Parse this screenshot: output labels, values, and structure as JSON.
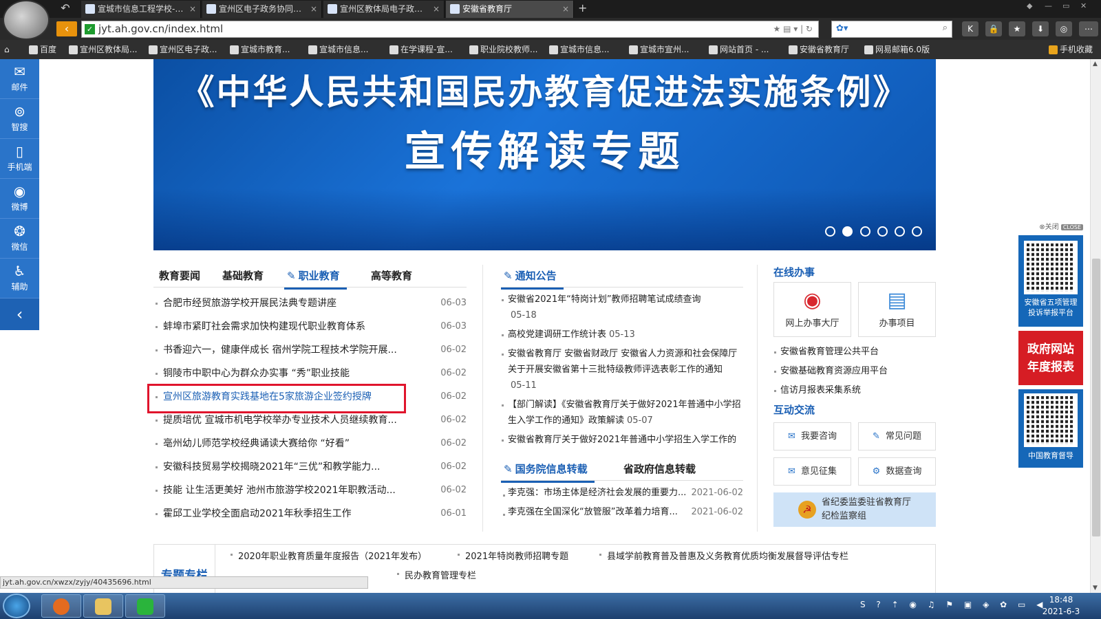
{
  "browser": {
    "tabs": [
      {
        "label": "宣城市信息工程学校-…",
        "close": "×"
      },
      {
        "label": "宣州区电子政务协同…",
        "close": "×"
      },
      {
        "label": "宣州区教体局电子政…",
        "close": "×"
      },
      {
        "label": "安徽省教育厅",
        "close": "×"
      }
    ],
    "new_tab": "+",
    "url": "jyt.ah.gov.cn/index.html",
    "bookmarks": [
      "百度",
      "宣州区教体局...",
      "宣州区电子政...",
      "宣城市教育...",
      "宣城市信息...",
      "在学课程-宣...",
      "职业院校教师...",
      "宣城市信息...",
      "宣城市宣州...",
      "网站首页 - ...",
      "安徽省教育厅",
      "网易邮箱6.0版"
    ],
    "mobile_fav": "手机收藏",
    "status_url": "jyt.ah.gov.cn/xwzx/zyjy/40435696.html"
  },
  "sidebar": {
    "items": [
      {
        "label": "邮件",
        "icon": "mail-icon"
      },
      {
        "label": "智搜",
        "icon": "search-icon"
      },
      {
        "label": "手机端",
        "icon": "phone-icon"
      },
      {
        "label": "微博",
        "icon": "weibo-icon"
      },
      {
        "label": "微信",
        "icon": "wechat-icon"
      },
      {
        "label": "辅助",
        "icon": "accessibility-icon"
      }
    ],
    "collapse": "‹"
  },
  "banner": {
    "line1": "《中华人民共和国民办教育促进法实施条例》",
    "line2": "宣传解读专题",
    "active_dot": 2,
    "dots": 6
  },
  "news": {
    "tabs": [
      "教育要闻",
      "基础教育",
      "职业教育",
      "高等教育"
    ],
    "active_tab": "职业教育",
    "items": [
      {
        "title": "合肥市经贸旅游学校开展民法典专题讲座",
        "date": "06-03"
      },
      {
        "title": "蚌埠市紧盯社会需求加快构建现代职业教育体系",
        "date": "06-03"
      },
      {
        "title": "书香迎六一，健康伴成长 宿州学院工程技术学院开展...",
        "date": "06-02"
      },
      {
        "title": "铜陵市中职中心为群众办实事 “秀”职业技能",
        "date": "06-02"
      },
      {
        "title": "宣州区旅游教育实践基地在5家旅游企业签约授牌",
        "date": "06-02"
      },
      {
        "title": "提质培优 宣城市机电学校举办专业技术人员继续教育...",
        "date": "06-02"
      },
      {
        "title": "亳州幼儿师范学校经典诵读大赛给你 “好看”",
        "date": "06-02"
      },
      {
        "title": "安徽科技贸易学校揭晓2021年“三优”和教学能力...",
        "date": "06-02"
      },
      {
        "title": "技能 让生活更美好 池州市旅游学校2021年职教活动...",
        "date": "06-02"
      },
      {
        "title": "霍邱工业学校全面启动2021年秋季招生工作",
        "date": "06-01"
      }
    ]
  },
  "notice": {
    "title": "通知公告",
    "items": [
      {
        "title": "安徽省2021年“特岗计划”教师招聘笔试成绩查询",
        "date": "05-18"
      },
      {
        "title": "高校党建调研工作统计表",
        "date": "05-13"
      },
      {
        "title": "安徽省教育厅 安徽省财政厅 安徽省人力资源和社会保障厅关于开展安徽省第十三批特级教师评选表彰工作的通知",
        "date": "05-11"
      },
      {
        "title": "【部门解读】《安徽省教育厅关于做好2021年普通中小学招生入学工作的通知》政策解读",
        "date": "05-07"
      },
      {
        "title": "安徽省教育厅关于做好2021年普通中小学招生入学工作的",
        "date": ""
      }
    ],
    "gov_tabs": [
      "国务院信息转载",
      "省政府信息转载"
    ],
    "gov_items": [
      {
        "title": "李克强：市场主体是经济社会发展的重要力...",
        "date": "2021-06-02"
      },
      {
        "title": "李克强在全国深化“放管服”改革着力培育...",
        "date": "2021-06-02"
      }
    ]
  },
  "online": {
    "title": "在线办事",
    "services": [
      {
        "label": "网上办事大厅",
        "icon": "hall-icon"
      },
      {
        "label": "办事项目",
        "icon": "list-icon"
      }
    ],
    "links": [
      "安徽省教育管理公共平台",
      "安徽基础教育资源应用平台",
      "信访月报表采集系统"
    ],
    "interact_title": "互动交流",
    "interact": [
      {
        "label": "我要咨询",
        "icon": "mail-icon"
      },
      {
        "label": "常见问题",
        "icon": "faq-icon"
      },
      {
        "label": "意见征集",
        "icon": "opinion-icon"
      },
      {
        "label": "数据查询",
        "icon": "data-icon"
      }
    ],
    "jiwei_line1": "省纪委监委驻省教育厅",
    "jiwei_line2": "纪检监察组"
  },
  "right_panel": {
    "close_label": "关闭",
    "close_badge": "CLOSE",
    "qr1_caption_1": "安徽省五项管理",
    "qr1_caption_2": "投诉举报平台",
    "report_1": "政府网站",
    "report_2": "年度报表",
    "qr2_caption": "中国教育督导"
  },
  "special": {
    "title": "专题专栏",
    "items": [
      "2020年职业教育质量年度报告（2021年发布）",
      "2021年特岗教师招聘专题",
      "县域学前教育普及普惠及义务教育优质均衡发展督导评估专栏",
      "民办教育管理专栏"
    ]
  },
  "taskbar": {
    "time": "18:48",
    "date": "2021-6-3"
  },
  "colors": {
    "accent": "#1a5fb4",
    "sidebar": "#2a74c9",
    "highlight_box": "#e0142c"
  }
}
